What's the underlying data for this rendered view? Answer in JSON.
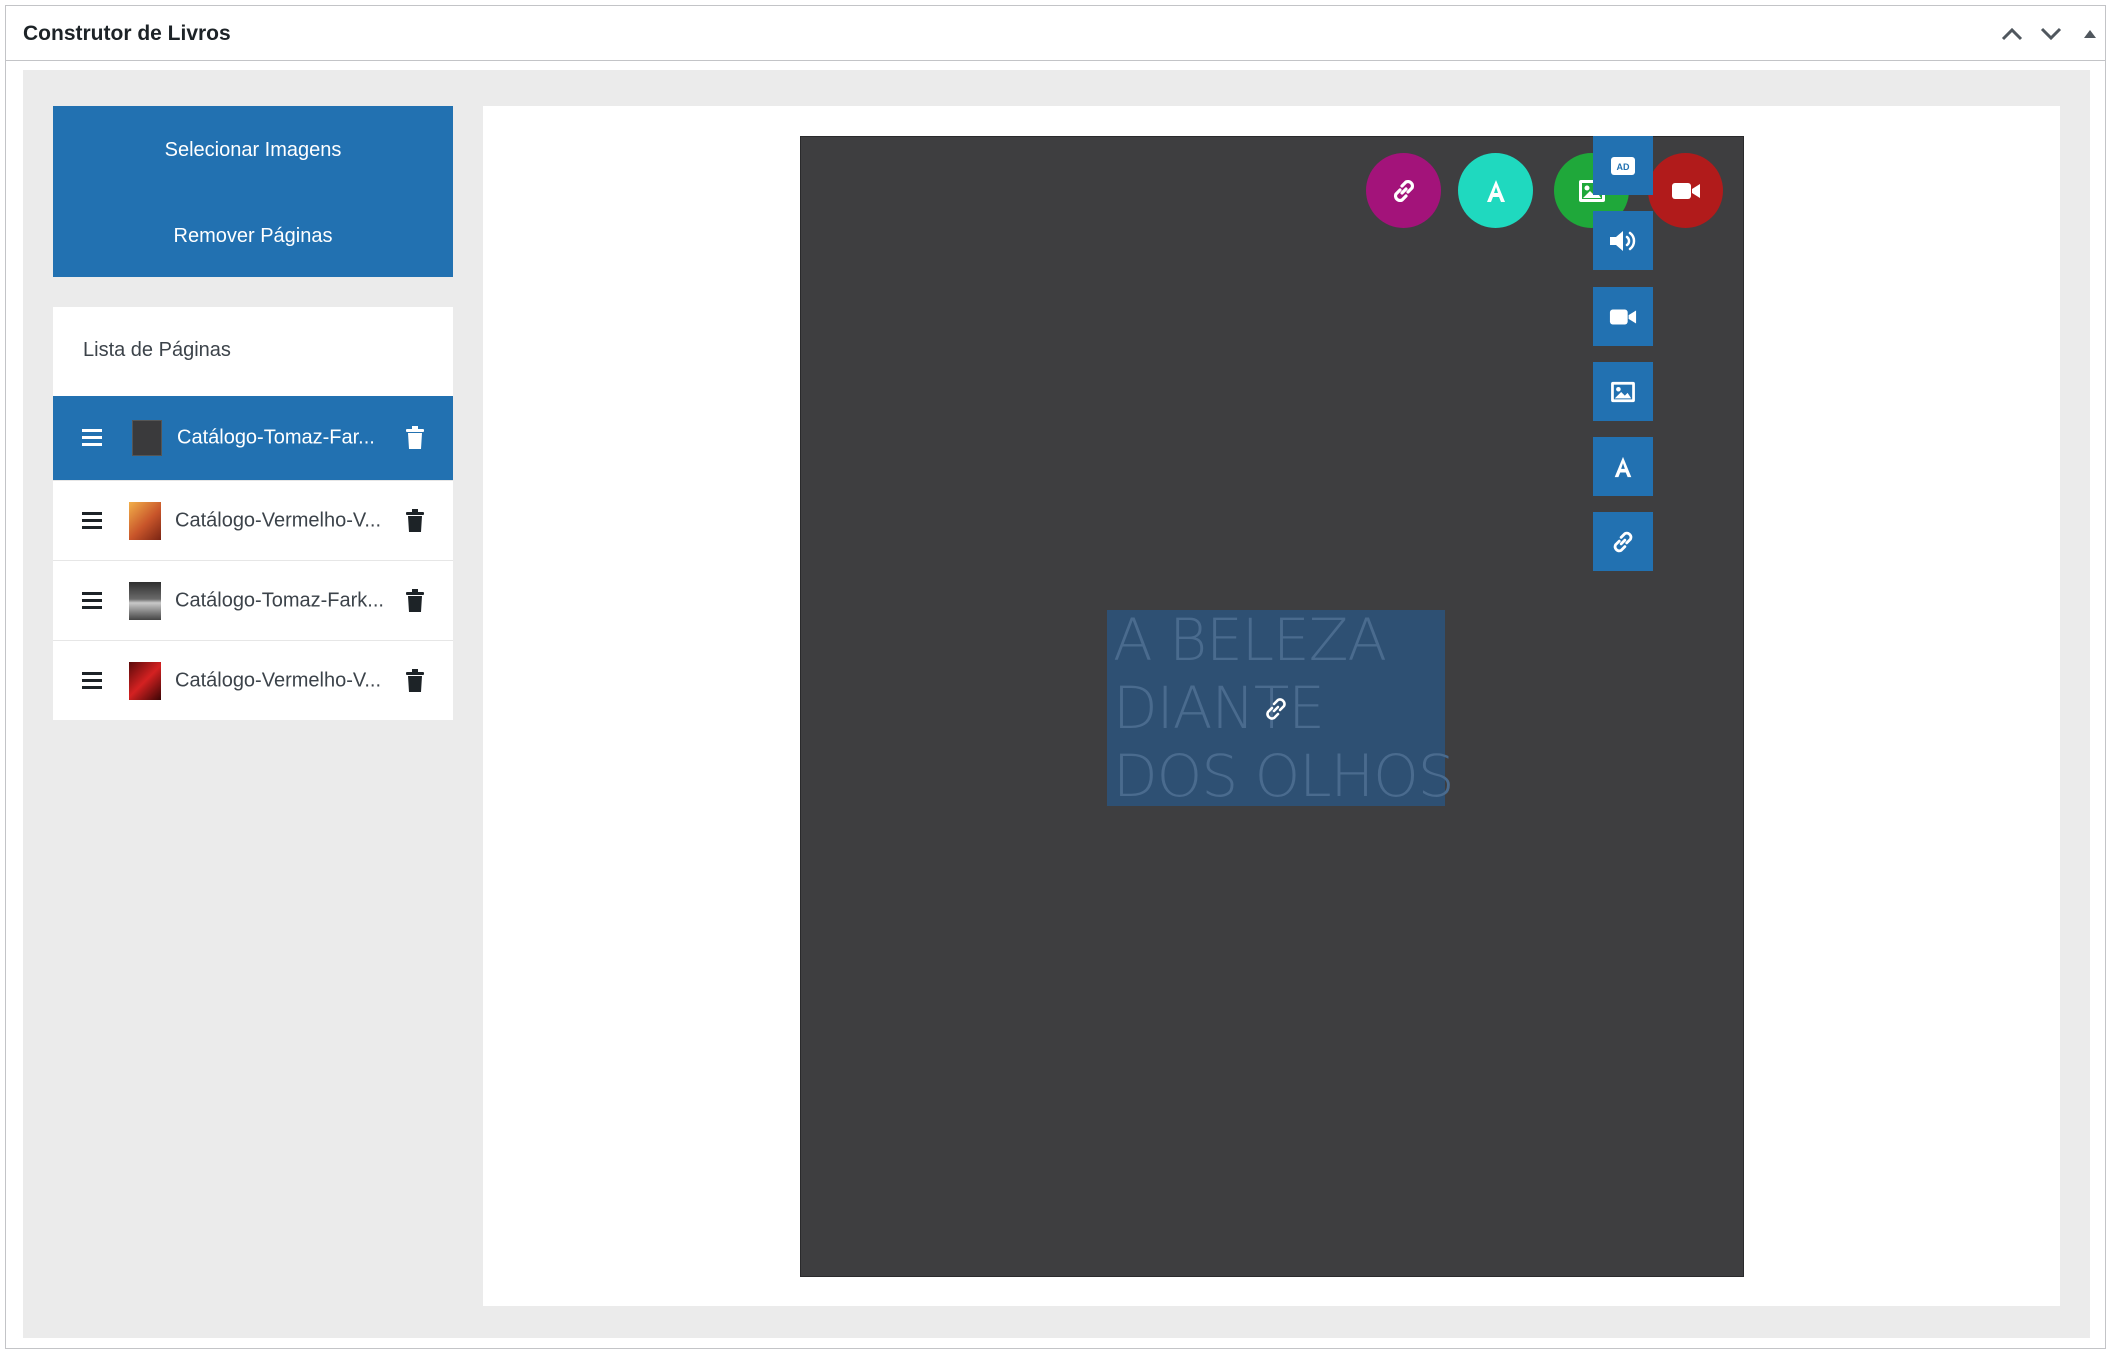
{
  "header": {
    "title": "Construtor de Livros"
  },
  "actions": {
    "select_images": "Selecionar Imagens",
    "remove_pages": "Remover Páginas"
  },
  "pages": {
    "title": "Lista de Páginas",
    "items": [
      {
        "label": "Catálogo-Tomaz-Far...",
        "thumb_color": "#3a3a3c",
        "active": true
      },
      {
        "label": "Catálogo-Vermelho-V...",
        "thumb_color": "#c8552a",
        "active": false
      },
      {
        "label": "Catálogo-Tomaz-Fark...",
        "thumb_color": "#5a5a5a",
        "active": false
      },
      {
        "label": "Catálogo-Vermelho-V...",
        "thumb_color": "#b01a1a",
        "active": false
      }
    ]
  },
  "editor": {
    "text_lines": [
      "A BELEZA",
      "DIANTE",
      "DOS OLHOS"
    ],
    "fab": [
      {
        "icon": "link-icon",
        "color": "#a3137a"
      },
      {
        "icon": "text-icon",
        "color": "#1fd9bf"
      },
      {
        "icon": "image-icon",
        "color": "#1fa83a"
      },
      {
        "icon": "video-icon",
        "color": "#b11b1b"
      }
    ],
    "toolbar": [
      "ad-icon",
      "audio-icon",
      "video-icon",
      "image-icon",
      "text-icon",
      "link-icon"
    ]
  },
  "colors": {
    "accent": "#2271b1",
    "page_bg": "#3e3e40",
    "text_block": "#2e5073"
  }
}
